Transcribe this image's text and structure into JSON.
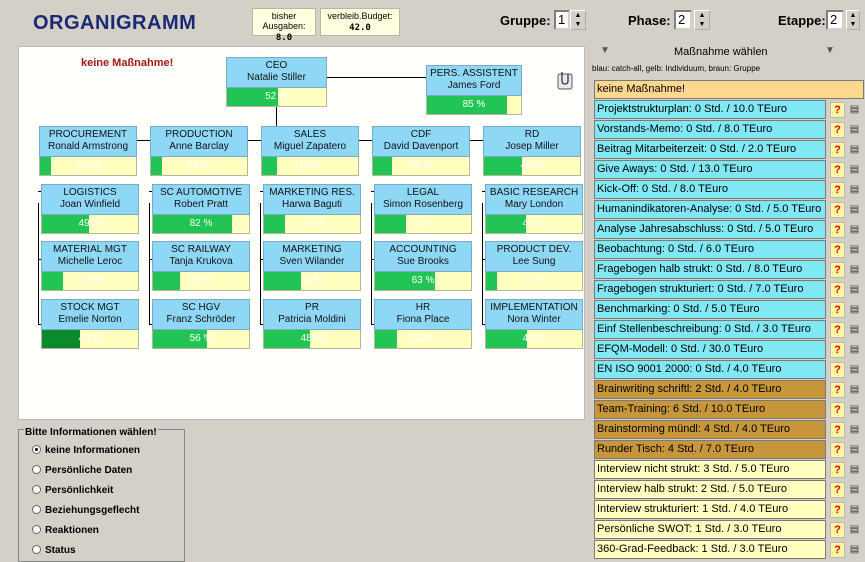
{
  "header": {
    "title": "ORGANIGRAMM",
    "spent_label": "bisher Ausgaben:",
    "spent_value": "8.0",
    "budget_label": "verbleib.Budget:",
    "budget_value": "42.0",
    "group_label": "Gruppe:",
    "group_value": "1",
    "phase_label": "Phase:",
    "phase_value": "2",
    "stage_label": "Etappe:",
    "stage_value": "2"
  },
  "org": {
    "no_measure": "keine Maßnahme!",
    "colors": {
      "fill_light": "#22c455",
      "fill_dark": "#0a8a2a",
      "box": "#8fd8f5"
    },
    "nodes": [
      {
        "id": "ceo",
        "title": "CEO",
        "name": "Natalie Stiller",
        "pct": "52 %",
        "progress": 0.52
      },
      {
        "id": "assistent",
        "title": "PERS. ASSISTENT",
        "name": "James Ford",
        "pct": "85 %",
        "progress": 0.85
      },
      {
        "id": "procurement",
        "title": "PROCUREMENT",
        "name": "Ronald Armstrong",
        "pct": "11 %",
        "progress": 0.11
      },
      {
        "id": "production",
        "title": "PRODUCTION",
        "name": "Anne Barclay",
        "pct": "11 %",
        "progress": 0.11
      },
      {
        "id": "sales",
        "title": "SALES",
        "name": "Miguel Zapatero",
        "pct": "16 %",
        "progress": 0.16
      },
      {
        "id": "cdf",
        "title": "CDF",
        "name": "David Davenport",
        "pct": "20 %",
        "progress": 0.2
      },
      {
        "id": "rd",
        "title": "RD",
        "name": "Josep Miller",
        "pct": "40 %",
        "progress": 0.4
      },
      {
        "id": "logistics",
        "title": "LOGISTICS",
        "name": "Joan Winfield",
        "pct": "49 %",
        "progress": 0.49
      },
      {
        "id": "sc-automotive",
        "title": "SC AUTOMOTIVE",
        "name": "Robert Pratt",
        "pct": "82 %",
        "progress": 0.82
      },
      {
        "id": "marketing-res",
        "title": "MARKETING RES.",
        "name": "Harwa Baguti",
        "pct": "22 %",
        "progress": 0.22
      },
      {
        "id": "legal",
        "title": "LEGAL",
        "name": "Simon Rosenberg",
        "pct": "32 %",
        "progress": 0.32
      },
      {
        "id": "basic-research",
        "title": "BASIC RESEARCH",
        "name": "Mary London",
        "pct": "42 %",
        "progress": 0.42
      },
      {
        "id": "material-mgt",
        "title": "MATERIAL MGT",
        "name": "Michelle Leroc",
        "pct": "22 %",
        "progress": 0.22
      },
      {
        "id": "sc-railway",
        "title": "SC RAILWAY",
        "name": "Tanja Krukova",
        "pct": "28 %",
        "progress": 0.28
      },
      {
        "id": "marketing",
        "title": "MARKETING",
        "name": "Sven Wilander",
        "pct": "39 %",
        "progress": 0.39
      },
      {
        "id": "accounting",
        "title": "ACCOUNTING",
        "name": "Sue Brooks",
        "pct": "63 %",
        "progress": 0.63
      },
      {
        "id": "product-dev",
        "title": "PRODUCT DEV.",
        "name": "Lee Sung",
        "pct": "11 %",
        "progress": 0.11
      },
      {
        "id": "stock-mgt",
        "title": "STOCK MGT",
        "name": "Emelie Norton",
        "pct": "40 %",
        "progress": 0.4,
        "dark": true
      },
      {
        "id": "sc-hgv",
        "title": "SC HGV",
        "name": "Franz Schröder",
        "pct": "56 %",
        "progress": 0.56
      },
      {
        "id": "pr",
        "title": "PR",
        "name": "Patricia Moldini",
        "pct": "48 %",
        "progress": 0.48
      },
      {
        "id": "hr",
        "title": "HR",
        "name": "Fiona Place",
        "pct": "23 %",
        "progress": 0.23
      },
      {
        "id": "implementation",
        "title": "IMPLEMENTATION",
        "name": "Nora Winter",
        "pct": "43 %",
        "progress": 0.43
      }
    ]
  },
  "info": {
    "title": "Bitte Informationen wählen!",
    "options": [
      {
        "label": "keine Informationen",
        "selected": true
      },
      {
        "label": "Persönliche Daten",
        "selected": false
      },
      {
        "label": "Persönlichkeit",
        "selected": false
      },
      {
        "label": "Beziehungsgeflecht",
        "selected": false
      },
      {
        "label": "Reaktionen",
        "selected": false
      },
      {
        "label": "Status",
        "selected": false
      }
    ]
  },
  "measures": {
    "title": "Maßnahme wählen",
    "legend": "blau: catch-all, gelb: Individuum, braun: Gruppe",
    "colors": {
      "none": "#ffd890",
      "blue": "#80e8f4",
      "brown": "#c8963a",
      "yellow": "#ffffc0"
    },
    "items": [
      {
        "label": "keine Maßnahme!",
        "color": "none",
        "icons": false
      },
      {
        "label": "Projektstrukturplan:  0 Std. / 10.0 TEuro",
        "color": "blue",
        "icons": true
      },
      {
        "label": "Vorstands-Memo:  0 Std. / 8.0 TEuro",
        "color": "blue",
        "icons": true
      },
      {
        "label": "Beitrag Mitarbeiterzeit:  0 Std. / 2.0 TEuro",
        "color": "blue",
        "icons": true
      },
      {
        "label": "Give Aways:  0 Std. / 13.0 TEuro",
        "color": "blue",
        "icons": true
      },
      {
        "label": "Kick-Off:  0 Std. / 8.0 TEuro",
        "color": "blue",
        "icons": true
      },
      {
        "label": "Humanindikatoren-Analyse:  0 Std. / 5.0 TEuro",
        "color": "blue",
        "icons": true
      },
      {
        "label": "Analyse Jahresabschluss:  0 Std. / 5.0 TEuro",
        "color": "blue",
        "icons": true
      },
      {
        "label": "Beobachtung:  0 Std. / 6.0 TEuro",
        "color": "blue",
        "icons": true
      },
      {
        "label": "Fragebogen halb strukt:  0 Std. / 8.0 TEuro",
        "color": "blue",
        "icons": true
      },
      {
        "label": "Fragebogen strukturiert:  0 Std. / 7.0 TEuro",
        "color": "blue",
        "icons": true
      },
      {
        "label": "Benchmarking:  0 Std. / 5.0 TEuro",
        "color": "blue",
        "icons": true
      },
      {
        "label": "Einf Stellenbeschreibung:  0 Std. / 3.0 TEuro",
        "color": "blue",
        "icons": true
      },
      {
        "label": "EFQM-Modell:  0 Std. / 30.0 TEuro",
        "color": "blue",
        "icons": true
      },
      {
        "label": "EN ISO 9001 2000:  0 Std. / 4.0 TEuro",
        "color": "blue",
        "icons": true
      },
      {
        "label": "Brainwriting schriftl:  2 Std. / 4.0 TEuro",
        "color": "brown",
        "icons": true
      },
      {
        "label": "Team-Training:  6 Std. / 10.0 TEuro",
        "color": "brown",
        "icons": true
      },
      {
        "label": "Brainstorming mündl:  4 Std. / 4.0 TEuro",
        "color": "brown",
        "icons": true
      },
      {
        "label": "Runder Tisch:  4 Std. / 7.0 TEuro",
        "color": "brown",
        "icons": true
      },
      {
        "label": "Interview nicht strukt:  3 Std. / 5.0 TEuro",
        "color": "yellow",
        "icons": true
      },
      {
        "label": "Interview halb strukt:  2 Std. / 5.0 TEuro",
        "color": "yellow",
        "icons": true
      },
      {
        "label": "Interview strukturiert:  1 Std. / 4.0 TEuro",
        "color": "yellow",
        "icons": true
      },
      {
        "label": "Persönliche SWOT:  1 Std. / 3.0 TEuro",
        "color": "yellow",
        "icons": true
      },
      {
        "label": "360-Grad-Feedback:  1 Std. / 3.0 TEuro",
        "color": "yellow",
        "icons": true
      }
    ]
  }
}
